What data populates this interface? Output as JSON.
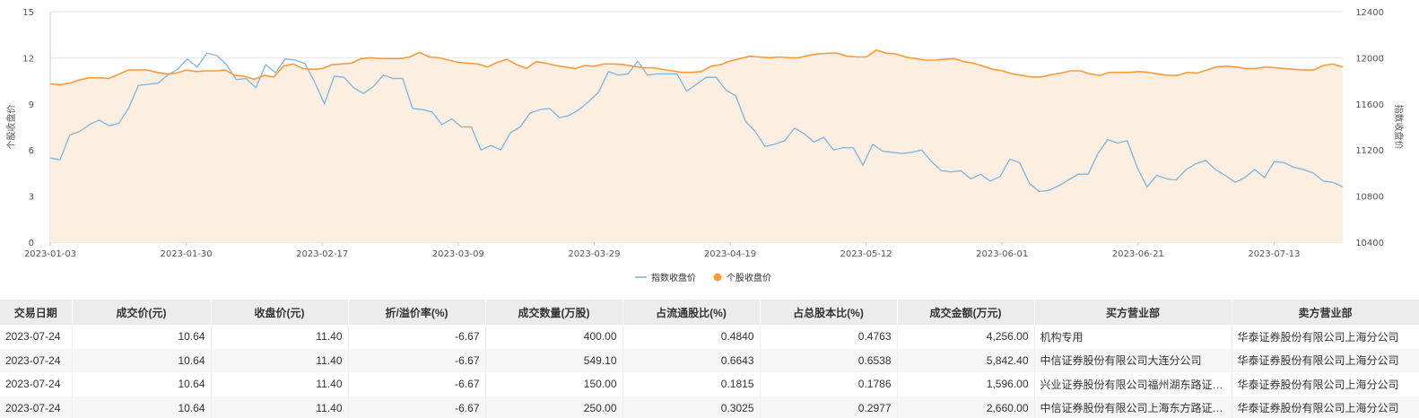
{
  "chart_data": {
    "type": "line",
    "dual_axis": true,
    "x_tick_labels": [
      "2023-01-03",
      "2023-01-30",
      "2023-02-17",
      "2023-03-09",
      "2023-03-29",
      "2023-04-19",
      "2023-05-12",
      "2023-06-01",
      "2023-06-21",
      "2023-07-13"
    ],
    "y_left": {
      "ticks": [
        "0",
        "3",
        "6",
        "9",
        "12",
        "15"
      ],
      "range": [
        0,
        15
      ],
      "label": "个股收盘价"
    },
    "y_right": {
      "ticks": [
        "10400",
        "10800",
        "11200",
        "11600",
        "12000",
        "12400"
      ],
      "range": [
        10400,
        12400
      ],
      "label": "指数收盘价"
    },
    "grid": true,
    "legend_position": "bottom",
    "series": [
      {
        "name": "指数收盘价",
        "axis": "right",
        "color": "#7cb5e0",
        "values": [
          11130,
          11115,
          11330,
          11360,
          11420,
          11460,
          11410,
          11430,
          11560,
          11760,
          11770,
          11780,
          11850,
          11900,
          11990,
          11920,
          12040,
          12020,
          11940,
          11810,
          11820,
          11740,
          11940,
          11870,
          11990,
          11980,
          11950,
          11790,
          11600,
          11840,
          11830,
          11740,
          11690,
          11750,
          11850,
          11820,
          11820,
          11560,
          11550,
          11530,
          11420,
          11470,
          11400,
          11400,
          11200,
          11240,
          11200,
          11350,
          11400,
          11520,
          11550,
          11560,
          11480,
          11500,
          11550,
          11620,
          11700,
          11880,
          11850,
          11860,
          11970,
          11850,
          11860,
          11860,
          11860,
          11710,
          11770,
          11830,
          11830,
          11720,
          11670,
          11450,
          11360,
          11230,
          11250,
          11280,
          11390,
          11340,
          11270,
          11310,
          11200,
          11220,
          11220,
          11070,
          11250,
          11190,
          11180,
          11170,
          11180,
          11200,
          11100,
          11020,
          11010,
          11020,
          10950,
          10990,
          10930,
          10970,
          11120,
          11090,
          10910,
          10840,
          10850,
          10890,
          10940,
          10990,
          10990,
          11170,
          11290,
          11260,
          11280,
          11050,
          10880,
          10980,
          10950,
          10940,
          11030,
          11080,
          11110,
          11030,
          10980,
          10920,
          10960,
          11030,
          10960,
          11100,
          11090,
          11050,
          11030,
          11000,
          10930,
          10920,
          10880
        ]
      },
      {
        "name": "个股收盘价",
        "axis": "left",
        "color": "#ff9a3c",
        "values": [
          10.3,
          10.25,
          10.35,
          10.55,
          10.7,
          10.7,
          10.65,
          10.9,
          11.2,
          11.2,
          11.2,
          11.05,
          10.95,
          11.0,
          11.2,
          11.1,
          11.15,
          11.15,
          11.2,
          10.85,
          10.8,
          10.6,
          10.85,
          10.75,
          11.45,
          11.6,
          11.3,
          11.25,
          11.3,
          11.55,
          11.6,
          11.65,
          11.95,
          12.0,
          11.95,
          11.95,
          11.95,
          12.05,
          12.35,
          12.05,
          12.0,
          11.85,
          11.7,
          11.65,
          11.6,
          11.4,
          11.7,
          11.9,
          11.55,
          11.3,
          11.75,
          11.65,
          11.5,
          11.4,
          11.3,
          11.5,
          11.45,
          11.6,
          11.6,
          11.55,
          11.45,
          11.35,
          11.35,
          11.25,
          11.15,
          11.05,
          11.05,
          11.1,
          11.45,
          11.55,
          11.8,
          11.95,
          12.1,
          12.05,
          12.0,
          12.05,
          12.0,
          12.0,
          12.15,
          12.25,
          12.3,
          12.3,
          12.1,
          12.05,
          12.05,
          12.5,
          12.3,
          12.25,
          12.05,
          11.95,
          11.85,
          11.85,
          11.9,
          11.95,
          11.75,
          11.65,
          11.45,
          11.25,
          11.15,
          10.95,
          10.85,
          10.75,
          10.75,
          10.9,
          11.0,
          11.15,
          11.15,
          10.95,
          10.85,
          11.05,
          11.05,
          11.05,
          11.1,
          11.05,
          10.95,
          10.85,
          10.85,
          11.05,
          11.0,
          11.2,
          11.4,
          11.45,
          11.4,
          11.3,
          11.3,
          11.4,
          11.35,
          11.3,
          11.25,
          11.2,
          11.2,
          11.5,
          11.6,
          11.4
        ]
      }
    ]
  },
  "table": {
    "headers": [
      "交易日期",
      "成交价(元)",
      "收盘价(元)",
      "折/溢价率(%)",
      "成交数量(万股)",
      "占流通股比(%)",
      "占总股本比(%)",
      "成交金额(万元)",
      "买方营业部",
      "卖方营业部"
    ],
    "rows": [
      [
        "2023-07-24",
        "10.64",
        "11.40",
        "-6.67",
        "400.00",
        "0.4840",
        "0.4763",
        "4,256.00",
        "机构专用",
        "华泰证券股份有限公司上海分公司"
      ],
      [
        "2023-07-24",
        "10.64",
        "11.40",
        "-6.67",
        "549.10",
        "0.6643",
        "0.6538",
        "5,842.40",
        "中信证券股份有限公司大连分公司",
        "华泰证券股份有限公司上海分公司"
      ],
      [
        "2023-07-24",
        "10.64",
        "11.40",
        "-6.67",
        "150.00",
        "0.1815",
        "0.1786",
        "1,596.00",
        "兴业证券股份有限公司福州湖东路证券营业部",
        "华泰证券股份有限公司上海分公司"
      ],
      [
        "2023-07-24",
        "10.64",
        "11.40",
        "-6.67",
        "250.00",
        "0.3025",
        "0.2977",
        "2,660.00",
        "中信证券股份有限公司上海东方路证券营业部",
        "华泰证券股份有限公司上海分公司"
      ]
    ]
  }
}
